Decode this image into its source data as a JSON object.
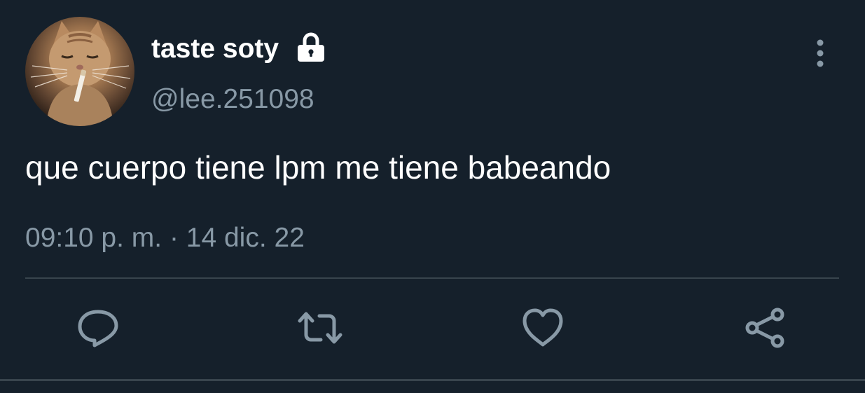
{
  "tweet": {
    "display_name": "taste soty",
    "handle": "@lee.251098",
    "text": "que cuerpo tiene lpm me tiene babeando",
    "timestamp": "09:10 p. m. · 14 dic. 22",
    "protected_icon": "lock-icon",
    "more_icon": "more-vertical-icon"
  },
  "actions": [
    {
      "name": "reply",
      "icon": "reply-icon"
    },
    {
      "name": "retweet",
      "icon": "retweet-icon"
    },
    {
      "name": "like",
      "icon": "heart-icon"
    },
    {
      "name": "share",
      "icon": "share-icon"
    }
  ],
  "colors": {
    "background": "#15202b",
    "primary_text": "#ffffff",
    "secondary_text": "#8899a6",
    "divider": "#38444d"
  }
}
